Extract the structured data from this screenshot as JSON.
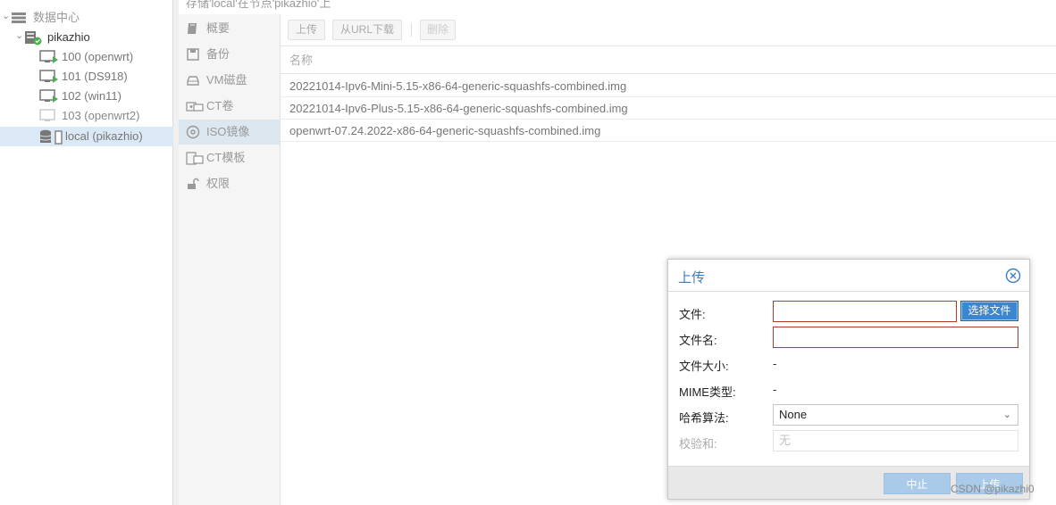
{
  "tree": {
    "datacenter": "数据中心",
    "node": "pikazhio",
    "items": [
      {
        "label": "100 (openwrt)",
        "state": "running"
      },
      {
        "label": "101 (DS918)",
        "state": "running"
      },
      {
        "label": "102 (win11)",
        "state": "running"
      },
      {
        "label": "103 (openwrt2)",
        "state": "stopped"
      }
    ],
    "storage": "local (pikazhio)"
  },
  "breadcrumb": "存储'local'在节点'pikazhio'上",
  "nav": {
    "items": [
      {
        "label": "概要",
        "icon": "book-icon"
      },
      {
        "label": "备份",
        "icon": "floppy-icon"
      },
      {
        "label": "VM磁盘",
        "icon": "hdd-icon"
      },
      {
        "label": "CT卷",
        "icon": "ct-volume-icon"
      },
      {
        "label": "ISO镜像",
        "icon": "disc-icon"
      },
      {
        "label": "CT模板",
        "icon": "ct-template-icon"
      },
      {
        "label": "权限",
        "icon": "unlock-icon"
      }
    ],
    "active": "ISO镜像"
  },
  "toolbar": {
    "upload": "上传",
    "download_url": "从URL下载",
    "delete": "删除"
  },
  "table": {
    "column_name": "名称",
    "rows": [
      "20221014-Ipv6-Mini-5.15-x86-64-generic-squashfs-combined.img",
      "20221014-Ipv6-Plus-5.15-x86-64-generic-squashfs-combined.img",
      "openwrt-07.24.2022-x86-64-generic-squashfs-combined.img"
    ]
  },
  "dialog": {
    "title": "上传",
    "file_label": "文件:",
    "choose_file": "选择文件",
    "filename_label": "文件名:",
    "filesize_label": "文件大小:",
    "filesize_value": "-",
    "mime_label": "MIME类型:",
    "mime_value": "-",
    "hash_label": "哈希算法:",
    "hash_value": "None",
    "checksum_label": "校验和:",
    "checksum_placeholder": "无",
    "abort": "中止",
    "upload": "上传"
  },
  "watermark": "CSDN @pikazhi0",
  "colors": {
    "accent": "#3b86d1",
    "invalid_border": "#b5382a",
    "selected_row": "#dbe8f5",
    "disabled_button": "#a9cbe9"
  }
}
